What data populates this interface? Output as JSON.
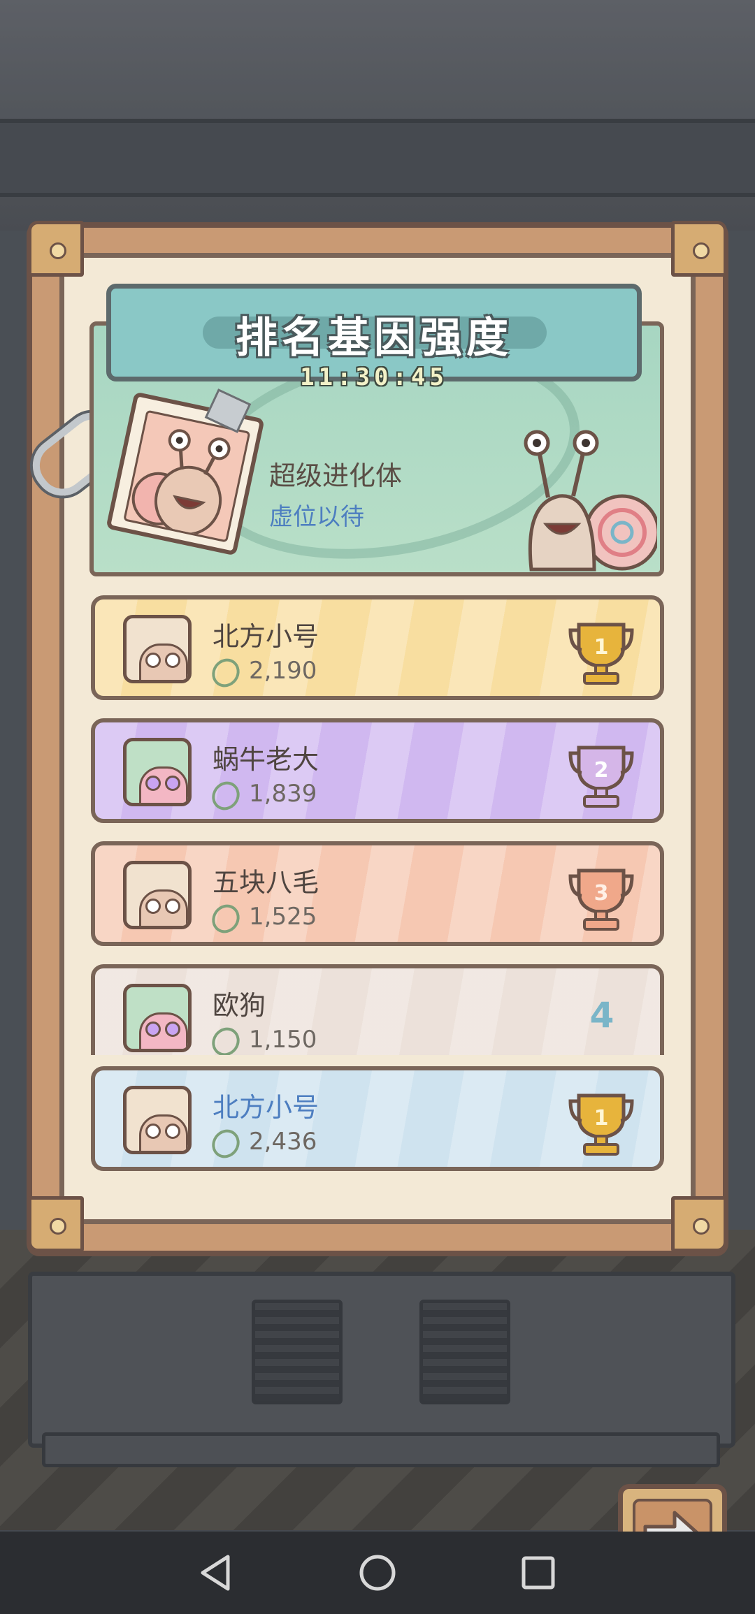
{
  "panel": {
    "title": "排名基因强度",
    "timer": "11:30:45",
    "featured": {
      "label": "超级进化体",
      "status": "虚位以待"
    }
  },
  "rankings": [
    {
      "rank": 1,
      "name": "北方小号",
      "score": "2,190",
      "trophy": "gold",
      "trophy_label": "1"
    },
    {
      "rank": 2,
      "name": "蜗牛老大",
      "score": "1,839",
      "trophy": "silver",
      "trophy_label": "2"
    },
    {
      "rank": 3,
      "name": "五块八毛",
      "score": "1,525",
      "trophy": "bronze",
      "trophy_label": "3"
    },
    {
      "rank": 4,
      "name": "欧狗",
      "score": "1,150",
      "trophy": "none",
      "trophy_label": "4"
    }
  ],
  "self_entry": {
    "name": "北方小号",
    "score": "2,436",
    "trophy": "gold",
    "trophy_label": "1"
  },
  "buttons": {
    "next": "arrow-right-icon"
  },
  "navbar": {
    "back": "back-triangle-icon",
    "home": "home-circle-icon",
    "recents": "recents-square-icon"
  },
  "colors": {
    "row_gold": "#f8dea0",
    "row_silver": "#d0b8f0",
    "row_bronze": "#f6c8b2",
    "row_plain": "#ece1da",
    "row_self": "#cfe3ef",
    "accent_blue": "#4d7ec0",
    "title_banner": "#8ac8c6"
  }
}
